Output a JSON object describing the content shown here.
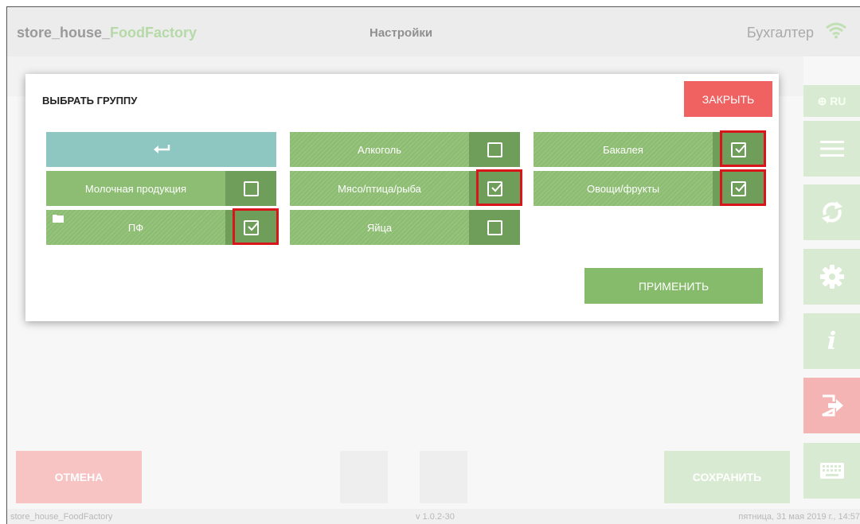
{
  "header": {
    "app_title_prefix": "store_house_",
    "app_title_accent": "FoodFactory",
    "screen_title": "Настройки",
    "user": "Бухгалтер",
    "wifi_icon": "wifi-icon"
  },
  "rail": {
    "lang": "⊕ RU",
    "info": "i"
  },
  "modal": {
    "title": "ВЫБРАТЬ ГРУППУ",
    "close_label": "ЗАКРЫТЬ",
    "apply_label": "ПРИМЕНИТЬ",
    "back_icon": "return-arrow-icon",
    "groups": [
      {
        "label": "Алкоголь",
        "checked": false,
        "highlighted": false
      },
      {
        "label": "Бакалея",
        "checked": true,
        "highlighted": true
      },
      {
        "label": "Молочная продукция",
        "checked": false,
        "highlighted": false
      },
      {
        "label": "Мясо/птица/рыба",
        "checked": true,
        "highlighted": true
      },
      {
        "label": "Овощи/фрукты",
        "checked": true,
        "highlighted": true
      },
      {
        "label": "ПФ",
        "checked": true,
        "highlighted": true,
        "folder": true
      },
      {
        "label": "Яйца",
        "checked": false,
        "highlighted": false
      }
    ]
  },
  "bottom": {
    "cancel_label": "ОТМЕНА",
    "save_label": "СОХРАНИТЬ"
  },
  "footer": {
    "app": "store_house_FoodFactory",
    "version": "v 1.0.2-30",
    "datetime": "пятница, 31 мая 2019 г., 14:57"
  },
  "colors": {
    "tile_green": "#8dbd72",
    "checkbox_cell": "#6f9d5a",
    "back_tile": "#8ec7c1",
    "close_red": "#f06262",
    "highlight_red": "#d9151c"
  }
}
